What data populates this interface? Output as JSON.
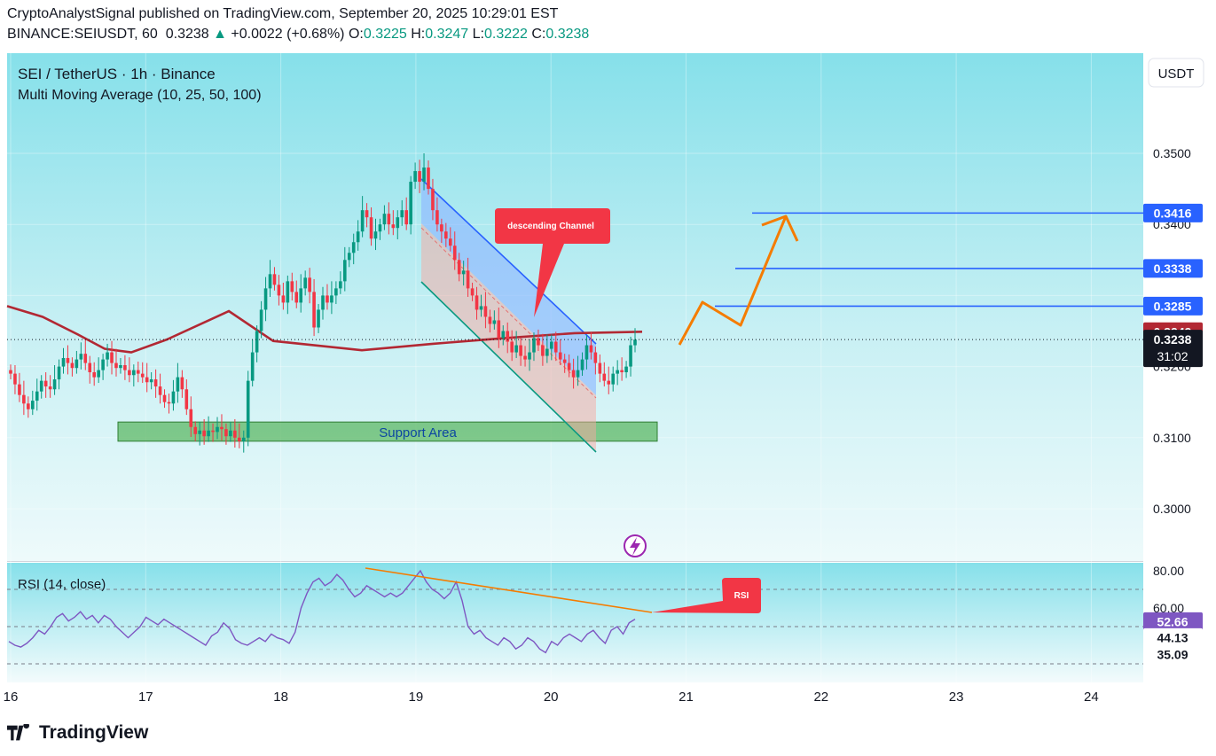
{
  "header": {
    "line1": "CryptoAnalystSignal published on TradingView.com, September 20, 2025 10:29:01 EST",
    "symbol": "BINANCE:SEIUSDT, 60",
    "last": "0.3238",
    "arrow": "▲",
    "change": "+0.0022 (+0.68%)",
    "o_label": "O:",
    "o": "0.3225",
    "h_label": "H:",
    "h": "0.3247",
    "l_label": "L:",
    "l": "0.3222",
    "c_label": "C:",
    "c": "0.3238"
  },
  "legend": {
    "title": "SEI / TetherUS · 1h · Binance",
    "indicator": "Multi Moving Average (10, 25, 50, 100)",
    "rsi": "RSI (14, close)"
  },
  "currency_button": "USDT",
  "annotations": {
    "channel": "descending Channel",
    "rsi": "RSI",
    "support": "Support Area"
  },
  "price_badges": {
    "target1": "0.3416",
    "target2": "0.3338",
    "target3": "0.3285",
    "ma": "0.3249",
    "last": "0.3238",
    "countdown": "31:02",
    "rsi_value": "52.66",
    "rsi_ma": "44.13",
    "rsi_low": "35.09"
  },
  "colors": {
    "bull": "#089981",
    "bear": "#f23645",
    "ma": "#b22833",
    "target_line": "#2962ff",
    "orange": "#f57c00",
    "support": "#4caf50",
    "rsi_line": "#7e57c2"
  },
  "branding": "TradingView",
  "chart_data": [
    {
      "type": "candlestick",
      "title": "SEI / TetherUS · 1h · Binance",
      "x_ticks": [
        "16",
        "17",
        "18",
        "19",
        "20",
        "21",
        "22",
        "23",
        "24"
      ],
      "y_ticks": [
        "0.3500",
        "0.3400",
        "0.3200",
        "0.3100",
        "0.3000"
      ],
      "ylim": [
        0.2945,
        0.3525
      ],
      "closes": [
        0.319,
        0.3175,
        0.316,
        0.3148,
        0.314,
        0.3152,
        0.3165,
        0.318,
        0.3172,
        0.3168,
        0.3182,
        0.32,
        0.3212,
        0.3205,
        0.3198,
        0.321,
        0.3218,
        0.3205,
        0.3192,
        0.3185,
        0.3195,
        0.321,
        0.322,
        0.3205,
        0.3198,
        0.3202,
        0.3195,
        0.3188,
        0.3195,
        0.319,
        0.3185,
        0.3178,
        0.3182,
        0.3172,
        0.316,
        0.315,
        0.3148,
        0.3165,
        0.3185,
        0.3168,
        0.314,
        0.3115,
        0.3105,
        0.311,
        0.3102,
        0.311,
        0.3108,
        0.3115,
        0.3112,
        0.3102,
        0.311,
        0.31,
        0.3095,
        0.31,
        0.318,
        0.322,
        0.325,
        0.328,
        0.331,
        0.333,
        0.3315,
        0.33,
        0.329,
        0.332,
        0.3305,
        0.329,
        0.331,
        0.3325,
        0.3305,
        0.3255,
        0.328,
        0.33,
        0.329,
        0.33,
        0.331,
        0.332,
        0.335,
        0.336,
        0.3375,
        0.339,
        0.342,
        0.341,
        0.338,
        0.339,
        0.34,
        0.3415,
        0.34,
        0.3395,
        0.341,
        0.342,
        0.34,
        0.346,
        0.3475,
        0.346,
        0.348,
        0.345,
        0.342,
        0.34,
        0.339,
        0.338,
        0.337,
        0.335,
        0.333,
        0.3335,
        0.331,
        0.33,
        0.328,
        0.3285,
        0.327,
        0.326,
        0.3265,
        0.324,
        0.325,
        0.3235,
        0.322,
        0.323,
        0.3215,
        0.321,
        0.322,
        0.324,
        0.323,
        0.3215,
        0.3225,
        0.3235,
        0.322,
        0.321,
        0.3205,
        0.3195,
        0.3185,
        0.3195,
        0.321,
        0.323,
        0.322,
        0.3205,
        0.319,
        0.318,
        0.3175,
        0.319,
        0.3195,
        0.3192,
        0.32,
        0.323,
        0.3238
      ],
      "ma100": [
        [
          0,
          0.3285
        ],
        [
          40,
          0.327
        ],
        [
          80,
          0.3245
        ],
        [
          110,
          0.3225
        ],
        [
          140,
          0.322
        ],
        [
          180,
          0.3238
        ],
        [
          250,
          0.3278
        ],
        [
          300,
          0.3236
        ],
        [
          400,
          0.3223
        ],
        [
          480,
          0.3232
        ],
        [
          560,
          0.324
        ],
        [
          640,
          0.3247
        ],
        [
          716,
          0.3249
        ]
      ],
      "last_price": 0.3238,
      "target_levels": [
        0.3416,
        0.3338,
        0.3285
      ],
      "support_area": [
        0.3095,
        0.3122
      ]
    },
    {
      "type": "line",
      "title": "RSI (14, close)",
      "y_ticks": [
        "80.00",
        "60.00"
      ],
      "ylim": [
        30,
        83
      ],
      "levels": [
        70,
        50,
        30
      ],
      "values": [
        42,
        40,
        39,
        41,
        44,
        48,
        46,
        50,
        55,
        57,
        53,
        55,
        58,
        54,
        56,
        52,
        56,
        54,
        50,
        47,
        44,
        47,
        50,
        55,
        53,
        51,
        54,
        52,
        50,
        48,
        46,
        44,
        42,
        40,
        45,
        47,
        52,
        49,
        43,
        41,
        40,
        42,
        44,
        42,
        46,
        44,
        43,
        41,
        47,
        60,
        68,
        74,
        76,
        72,
        74,
        78,
        75,
        70,
        66,
        68,
        72,
        70,
        68,
        66,
        68,
        66,
        68,
        72,
        76,
        80,
        74,
        70,
        68,
        65,
        68,
        74,
        64,
        50,
        46,
        48,
        44,
        42,
        40,
        44,
        42,
        38,
        40,
        44,
        42,
        38,
        36,
        42,
        40,
        44,
        46,
        44,
        42,
        46,
        48,
        44,
        41,
        48,
        50,
        46,
        52,
        54
      ]
    }
  ]
}
